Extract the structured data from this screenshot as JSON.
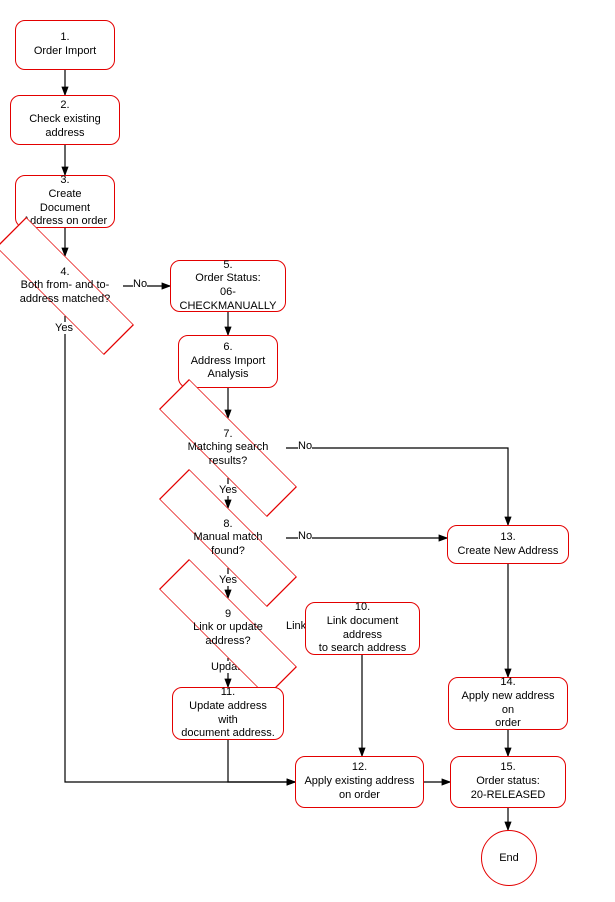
{
  "chart_data": {
    "type": "flowchart",
    "nodes": [
      {
        "id": "n1",
        "num": "1.",
        "label": "Order Import",
        "shape": "box"
      },
      {
        "id": "n2",
        "num": "2.",
        "label": "Check existing address",
        "shape": "box"
      },
      {
        "id": "n3",
        "num": "3.",
        "label": "Create Document Address on order",
        "shape": "box"
      },
      {
        "id": "n4",
        "num": "4.",
        "label": "Both from- and to-address matched?",
        "shape": "diamond"
      },
      {
        "id": "n5",
        "num": "5.",
        "label": "Order Status: 06-CHECKMANUALLY",
        "shape": "box"
      },
      {
        "id": "n6",
        "num": "6.",
        "label": "Address Import Analysis",
        "shape": "box"
      },
      {
        "id": "n7",
        "num": "7.",
        "label": "Matching search results?",
        "shape": "diamond"
      },
      {
        "id": "n8",
        "num": "8.",
        "label": "Manual match found?",
        "shape": "diamond"
      },
      {
        "id": "n9",
        "num": "9",
        "label": "Link or update address?",
        "shape": "diamond"
      },
      {
        "id": "n10",
        "num": "10.",
        "label": "Link document address to search address",
        "shape": "box"
      },
      {
        "id": "n11",
        "num": "11.",
        "label": "Update address with document address.",
        "shape": "box"
      },
      {
        "id": "n12",
        "num": "12.",
        "label": "Apply existing address on order",
        "shape": "box"
      },
      {
        "id": "n13",
        "num": "13.",
        "label": "Create New Address",
        "shape": "box"
      },
      {
        "id": "n14",
        "num": "14.",
        "label": "Apply new address on order",
        "shape": "box"
      },
      {
        "id": "n15",
        "num": "15.",
        "label": "Order status: 20-RELEASED",
        "shape": "box"
      },
      {
        "id": "end",
        "num": "",
        "label": "End",
        "shape": "circle"
      }
    ],
    "edges": [
      {
        "from": "n1",
        "to": "n2"
      },
      {
        "from": "n2",
        "to": "n3"
      },
      {
        "from": "n3",
        "to": "n4"
      },
      {
        "from": "n4",
        "to": "n5",
        "label": "No"
      },
      {
        "from": "n4",
        "to": "n12",
        "label": "Yes"
      },
      {
        "from": "n5",
        "to": "n6"
      },
      {
        "from": "n6",
        "to": "n7"
      },
      {
        "from": "n7",
        "to": "n8",
        "label": "Yes"
      },
      {
        "from": "n7",
        "to": "n13",
        "label": "No"
      },
      {
        "from": "n8",
        "to": "n9",
        "label": "Yes"
      },
      {
        "from": "n8",
        "to": "n13",
        "label": "No"
      },
      {
        "from": "n9",
        "to": "n10",
        "label": "Link"
      },
      {
        "from": "n9",
        "to": "n11",
        "label": "Update"
      },
      {
        "from": "n10",
        "to": "n12"
      },
      {
        "from": "n11",
        "to": "n12"
      },
      {
        "from": "n12",
        "to": "n15"
      },
      {
        "from": "n13",
        "to": "n14"
      },
      {
        "from": "n14",
        "to": "n15"
      },
      {
        "from": "n15",
        "to": "end"
      }
    ]
  },
  "nodes": {
    "n1": {
      "num": "1.",
      "label": "Order Import"
    },
    "n2": {
      "num": "2.",
      "label": "Check existing address"
    },
    "n3": {
      "num": "3.",
      "label1": "Create Document",
      "label2": "Address on order"
    },
    "n4": {
      "num": "4.",
      "label1": "Both from- and to-",
      "label2": "address matched?"
    },
    "n5": {
      "num": "5.",
      "label1": "Order Status:",
      "label2": "06-CHECKMANUALLY"
    },
    "n6": {
      "num": "6.",
      "label1": "Address Import",
      "label2": "Analysis"
    },
    "n7": {
      "num": "7.",
      "label1": "Matching search",
      "label2": "results?"
    },
    "n8": {
      "num": "8.",
      "label1": "Manual match",
      "label2": "found?"
    },
    "n9": {
      "num": "9",
      "label1": "Link or update",
      "label2": "address?"
    },
    "n10": {
      "num": "10.",
      "label1": "Link document address",
      "label2": "to search address"
    },
    "n11": {
      "num": "11.",
      "label1": "Update address with",
      "label2": "document address."
    },
    "n12": {
      "num": "12.",
      "label1": "Apply existing address",
      "label2": "on order"
    },
    "n13": {
      "num": "13.",
      "label": "Create New Address"
    },
    "n14": {
      "num": "14.",
      "label1": "Apply new address on",
      "label2": "order"
    },
    "n15": {
      "num": "15.",
      "label1": "Order status:",
      "label2": "20-RELEASED"
    },
    "end": {
      "label": "End"
    }
  },
  "edge_labels": {
    "no47": "No",
    "yes4": "Yes",
    "no7": "No",
    "yes7": "Yes",
    "no8": "No",
    "yes8": "Yes",
    "link": "Link",
    "update": "Update"
  }
}
